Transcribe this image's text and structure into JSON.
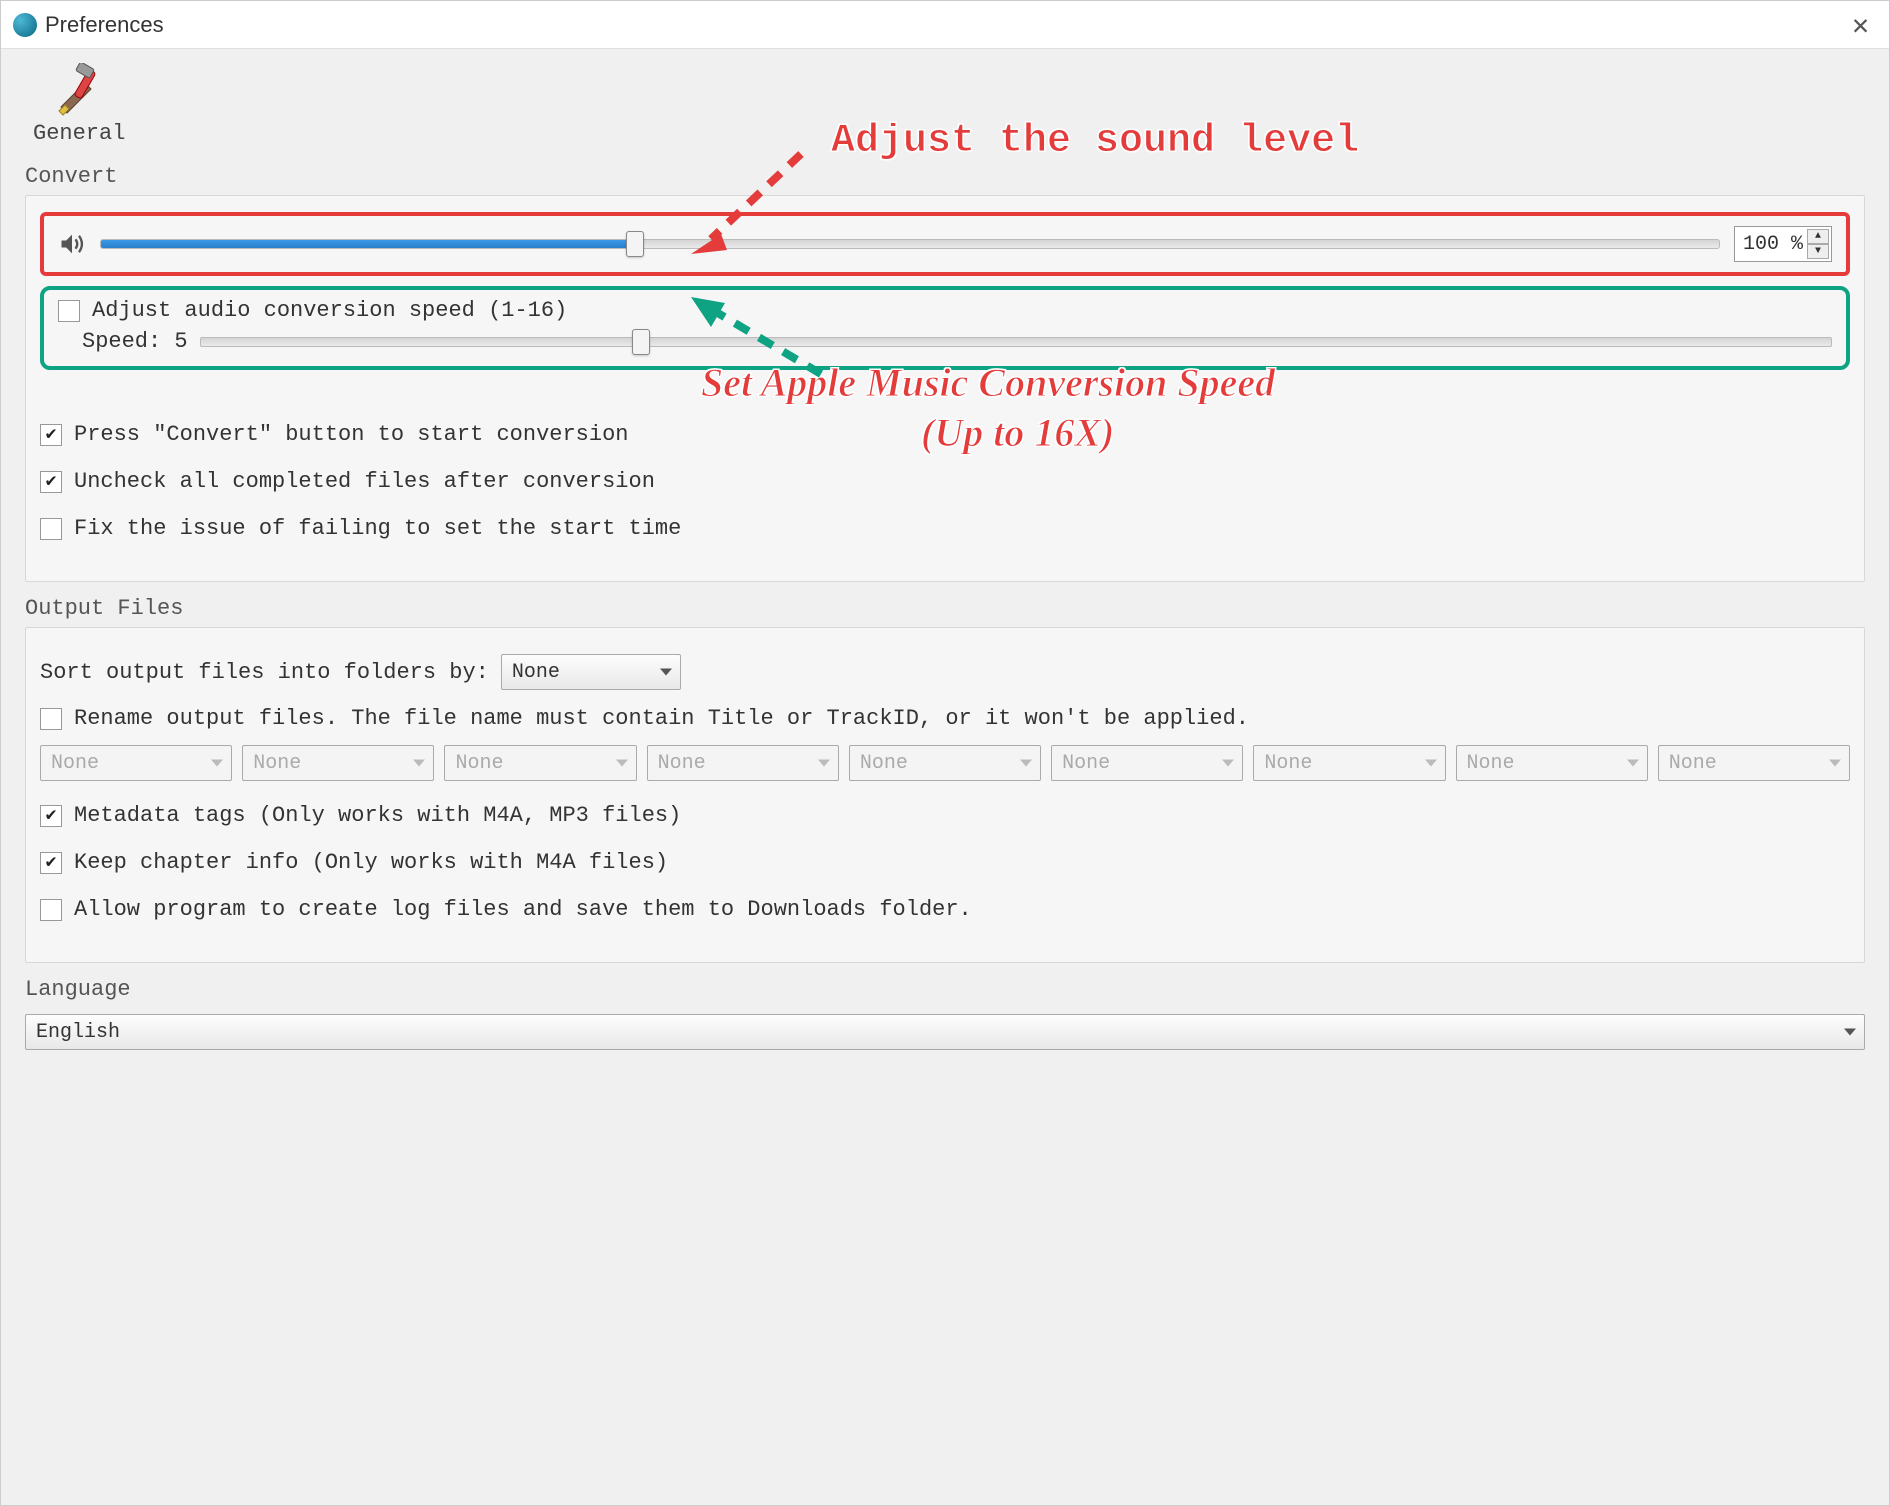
{
  "window": {
    "title": "Preferences"
  },
  "tab": {
    "general": "General"
  },
  "convert": {
    "section_label": "Convert",
    "volume_value": "100 %",
    "volume_fill_percent": 33,
    "adjust_speed_label": "Adjust audio conversion speed (1-16)",
    "adjust_speed_checked": false,
    "speed_label": "Speed: 5",
    "speed_thumb_percent": 27,
    "press_convert_label": "Press \"Convert\" button to start conversion",
    "press_convert_checked": true,
    "uncheck_completed_label": "Uncheck all completed files after conversion",
    "uncheck_completed_checked": true,
    "fix_issue_label": "Fix the issue of failing to set the start time",
    "fix_issue_checked": false
  },
  "output": {
    "section_label": "Output Files",
    "sort_label": "Sort output files into folders by:",
    "sort_value": "None",
    "rename_label": "Rename output files. The file name must contain Title or TrackID, or it won't be applied.",
    "rename_checked": false,
    "rename_selects": [
      "None",
      "None",
      "None",
      "None",
      "None",
      "None",
      "None",
      "None",
      "None"
    ],
    "metadata_label": "Metadata tags (Only works with M4A, MP3 files)",
    "metadata_checked": true,
    "chapter_label": "Keep chapter info (Only works with M4A files)",
    "chapter_checked": true,
    "log_label": "Allow program to create log files and save them to Downloads folder.",
    "log_checked": false
  },
  "language": {
    "section_label": "Language",
    "value": "English"
  },
  "annotations": {
    "sound_level": "Adjust the sound level",
    "conversion_speed_1": "Set Apple Music Conversion Speed",
    "conversion_speed_2": "(Up to 16X)"
  }
}
